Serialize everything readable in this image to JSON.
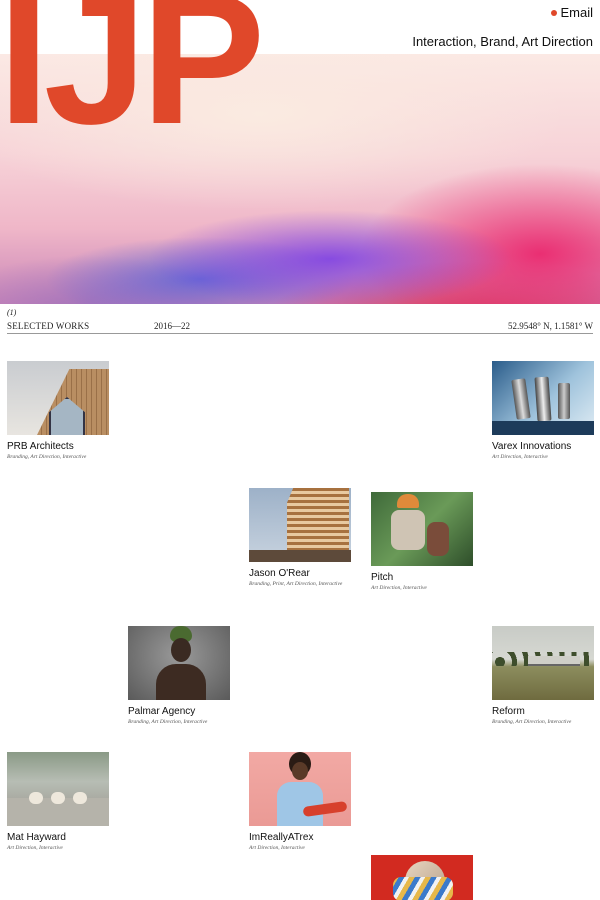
{
  "header": {
    "logo": "IJP",
    "email_label": "Email",
    "tagline": "Interaction, Brand, Art Direction"
  },
  "works_header": {
    "section_number": "(1)",
    "title": "SELECTED WORKS",
    "years": "2016—22",
    "coordinates": "52.9548° N, 1.1581° W"
  },
  "projects": [
    {
      "title": "PRB Architects",
      "tags": "Branding, Art Direction, Interactive"
    },
    {
      "title": "Varex Innovations",
      "tags": "Art Direction, Interactive"
    },
    {
      "title": "Jason O'Rear",
      "tags": "Branding, Print, Art Direction, Interactive"
    },
    {
      "title": "Pitch",
      "tags": "Art Direction, Interactive"
    },
    {
      "title": "Palmar Agency",
      "tags": "Branding, Art Direction, Interactive"
    },
    {
      "title": "Reform",
      "tags": "Branding, Art Direction, Interactive"
    },
    {
      "title": "Mat Hayward",
      "tags": "Art Direction, Interactive"
    },
    {
      "title": "ImReallyATrex",
      "tags": "Art Direction, Interactive"
    }
  ],
  "colors": {
    "accent": "#e0482a",
    "text": "#111111",
    "background": "#ffffff"
  }
}
